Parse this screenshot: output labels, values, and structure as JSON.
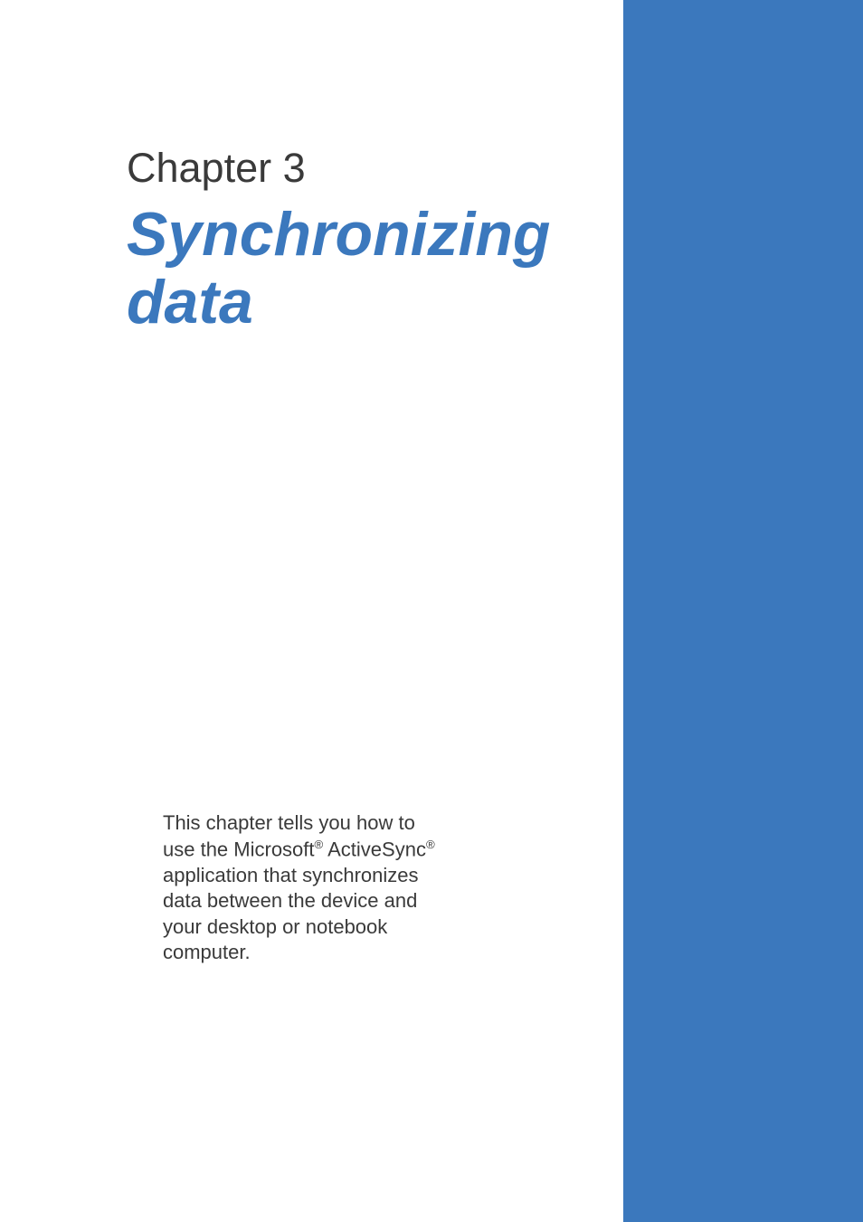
{
  "chapter": {
    "label": "Chapter 3",
    "title_line1": "Synchronizing",
    "title_line2": "data"
  },
  "description": {
    "part1": "This chapter tells you how to use the Microsoft",
    "reg1": "®",
    "part2": " ActiveSync",
    "reg2": "®",
    "part3": " application that synchronizes data between the device and your desktop or notebook computer."
  },
  "colors": {
    "sidebar": "#3b78bd",
    "title": "#3b78bd",
    "text": "#3a3a3a"
  }
}
